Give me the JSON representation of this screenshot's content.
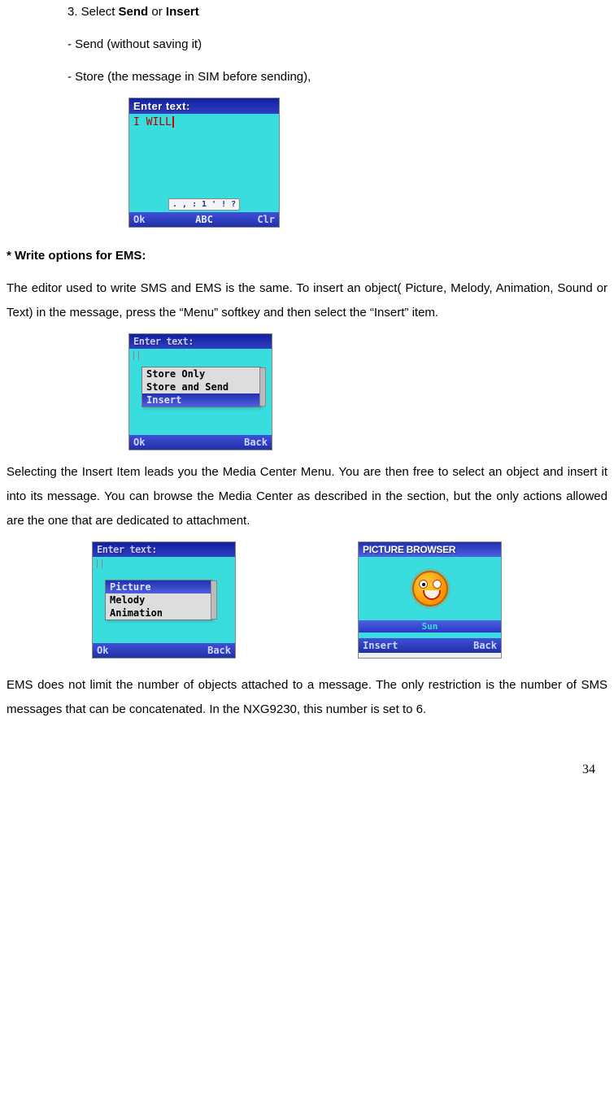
{
  "intro": {
    "step3_prefix": "3. Select ",
    "step3_bold1": "Send",
    "step3_conj": " or ",
    "step3_bold2": "Insert",
    "bullet1": "- Send    (without saving it)",
    "bullet2": "- Store (the message in SIM before sending),"
  },
  "phone1": {
    "title": "Enter text:",
    "typed": "I WILL",
    "input_pill": ". , : 1 ' ! ?",
    "sk_left": "Ok",
    "sk_mid": "ABC",
    "sk_right": "Clr"
  },
  "section1": {
    "heading": "* Write options for EMS:",
    "para1": "The editor used to write SMS and EMS is the same. To insert an object( Picture, Melody, Animation, Sound or Text) in the message, press the “Menu” softkey and then select the “Insert” item."
  },
  "phone2": {
    "title": "Enter text:",
    "menu1": "Store Only",
    "menu2": "Store and Send",
    "menu3": "Insert",
    "sk_left": "Ok",
    "sk_right": "Back"
  },
  "section2": {
    "para2": "Selecting the Insert Item leads you the Media Center Menu. You are then free to select an object and insert it into its message. You can browse the Media Center as described in the section, but the only actions allowed are the one that are dedicated to attachment."
  },
  "phone3": {
    "title": "Enter text:",
    "menu1": "Picture",
    "menu2": "Melody",
    "menu3": "Animation",
    "sk_left": "Ok",
    "sk_right": "Back"
  },
  "phone4": {
    "title": "PICTURE BROWSER",
    "pic_name": "Sun",
    "sk_left": "Insert",
    "sk_right": "Back"
  },
  "section3": {
    "para3": "EMS does not limit the number of objects attached to a message. The only restriction is the number of SMS messages that can be concatenated. In the NXG9230, this number is set to 6."
  },
  "page_number": "34"
}
